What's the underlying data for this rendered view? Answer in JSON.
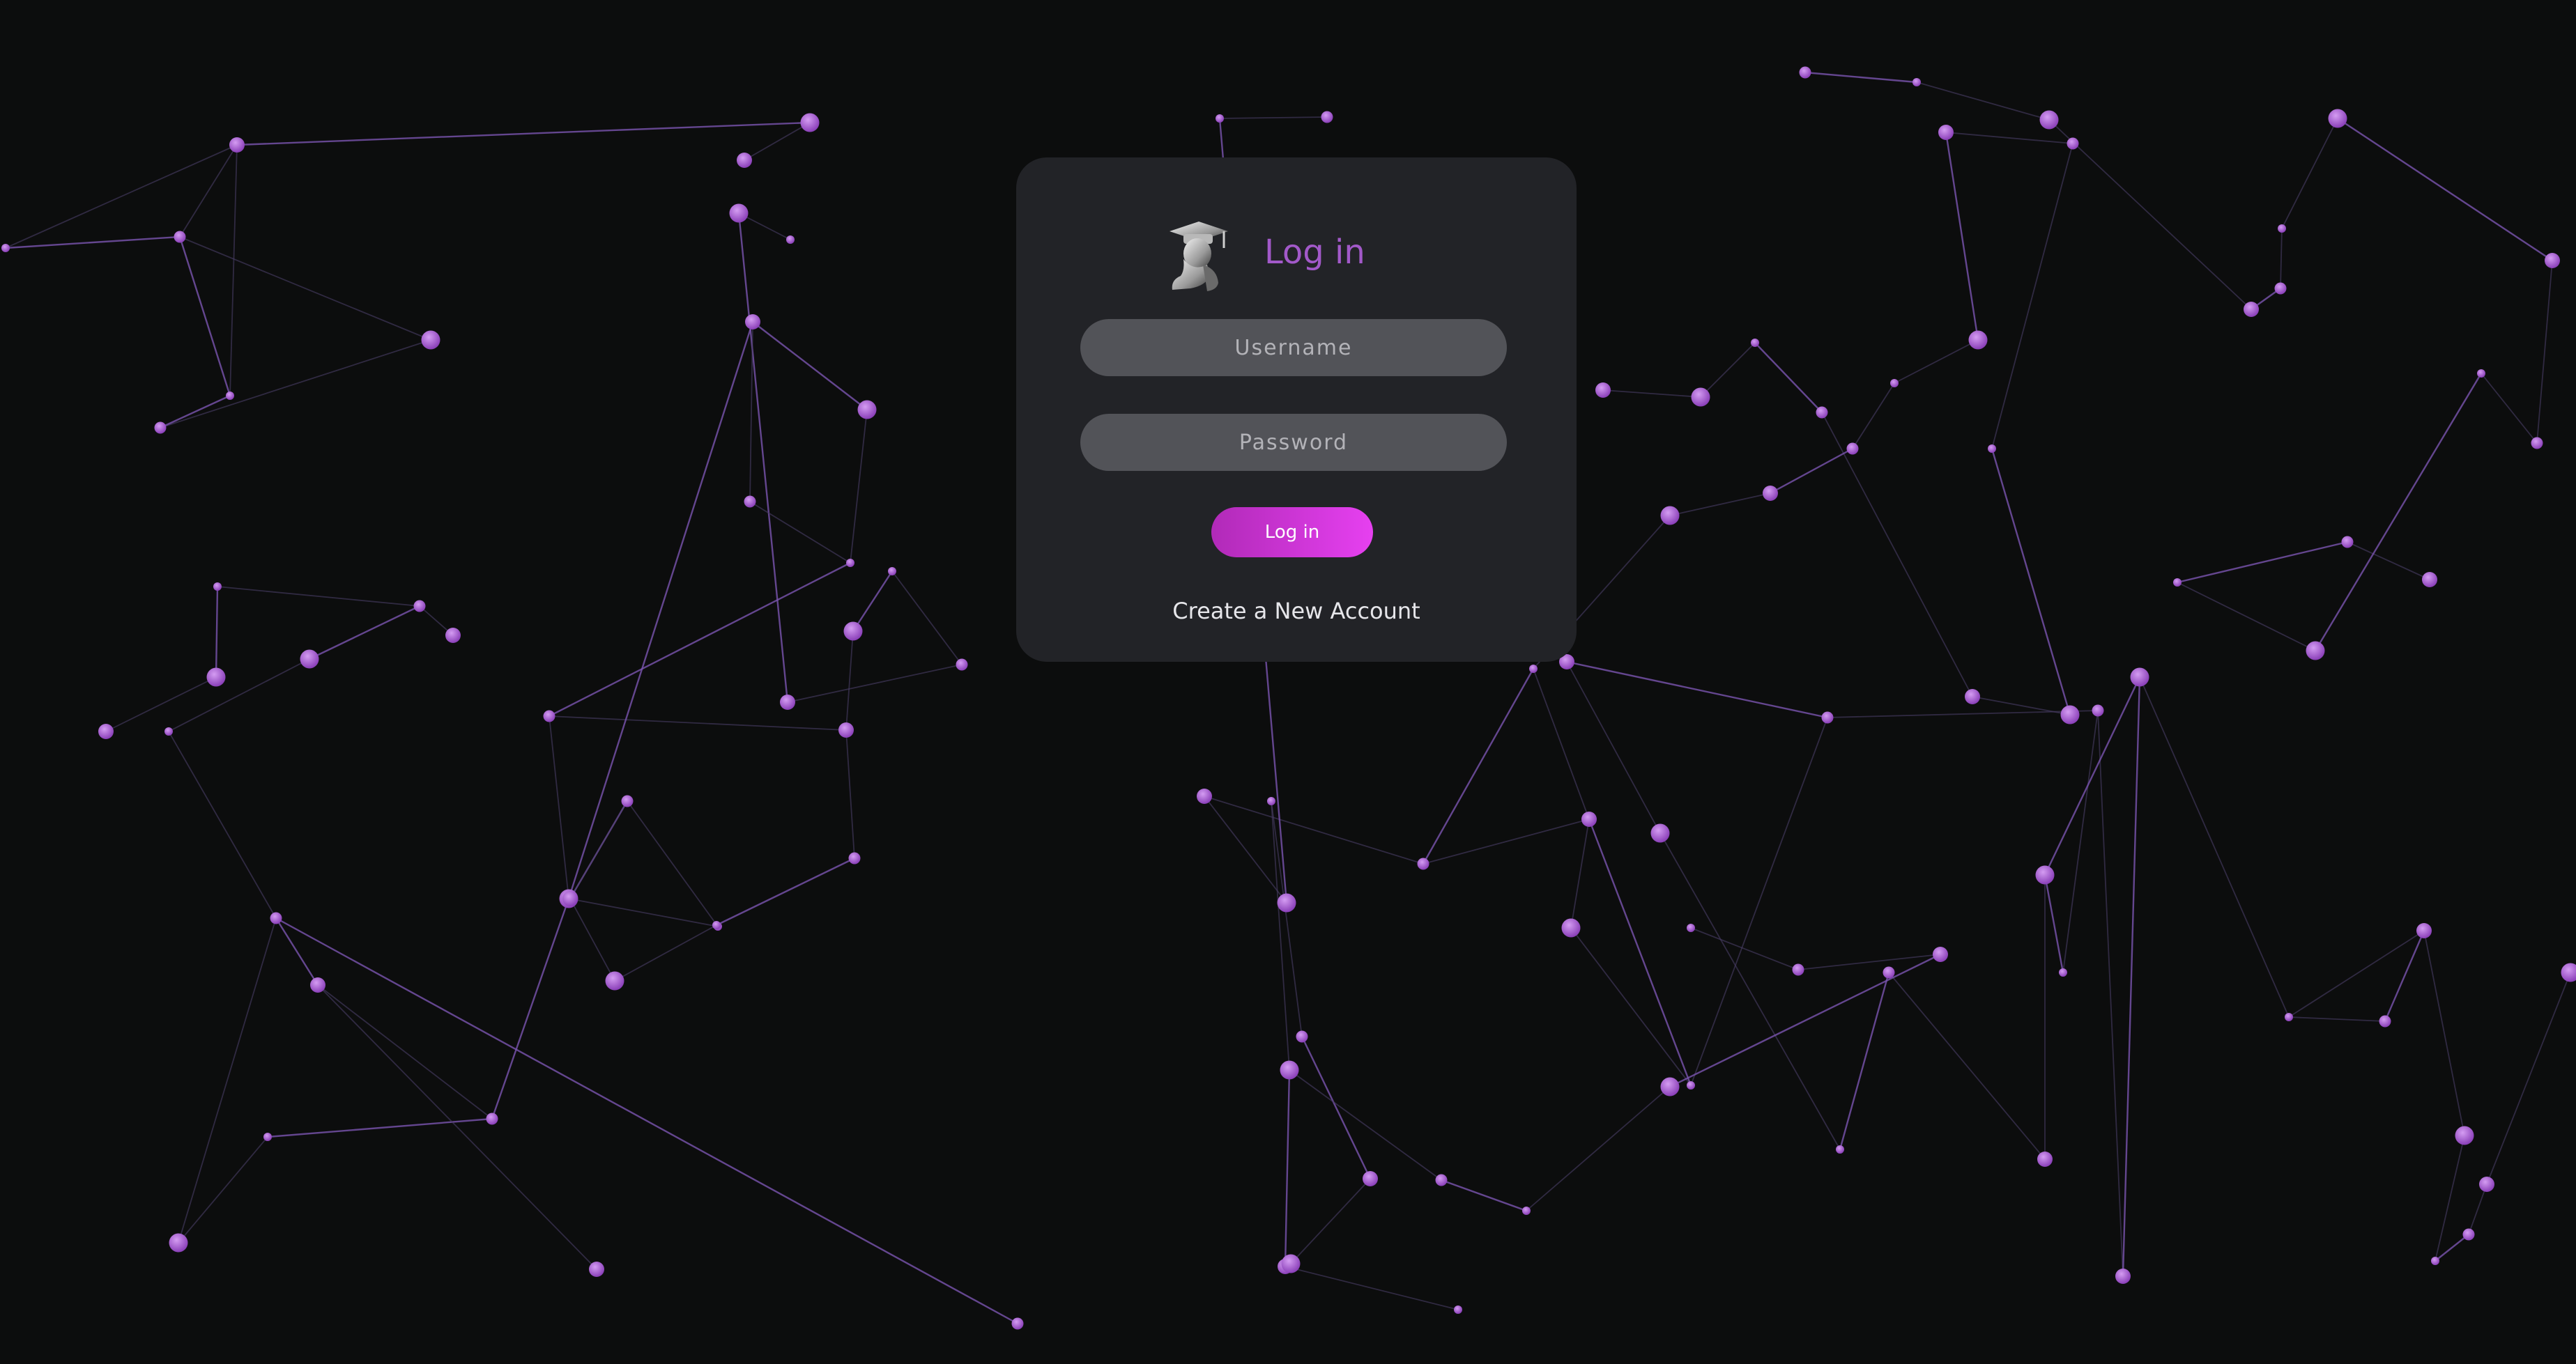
{
  "login": {
    "title": "Log in",
    "username_placeholder": "Username",
    "password_placeholder": "Password",
    "submit_label": "Log in",
    "create_account_label": "Create a New Account"
  },
  "icons": {
    "logo": "graduate-bust-icon"
  },
  "colors": {
    "background": "#0c0d0d",
    "card": "#222327",
    "accent": "#a259c9",
    "button_gradient_start": "#b12ab8",
    "button_gradient_end": "#e640f0",
    "node": "#9a55c8",
    "edge": "#6a4a9a"
  }
}
